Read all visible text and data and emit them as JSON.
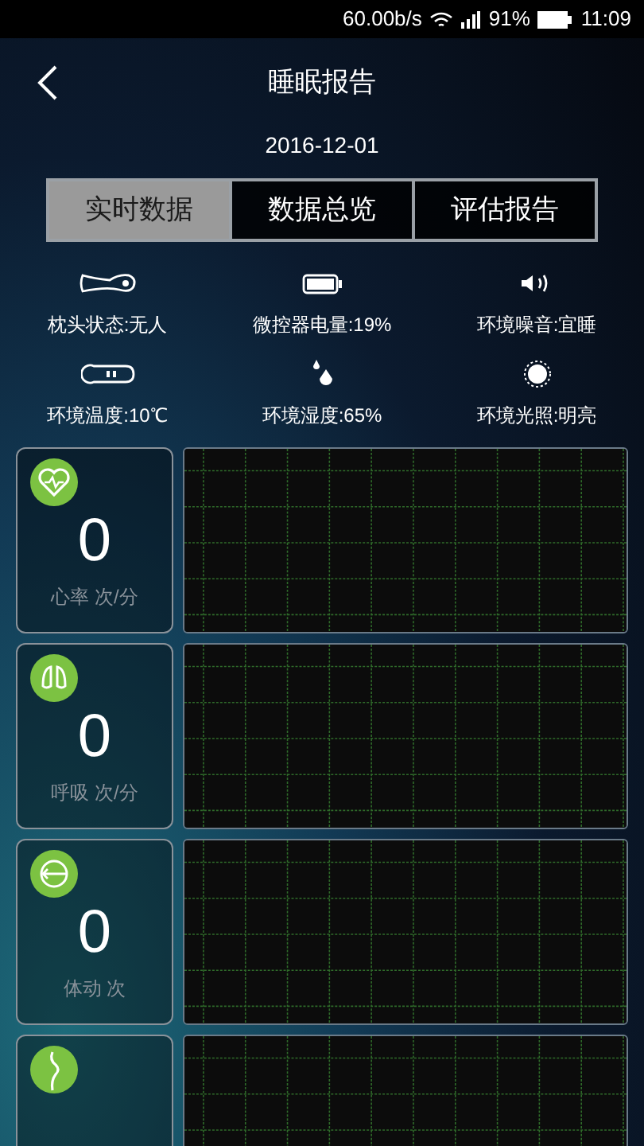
{
  "status_bar": {
    "speed": "60.00b/s",
    "battery": "91%",
    "time": "11:09"
  },
  "header": {
    "title": "睡眠报告",
    "date": "2016-12-01"
  },
  "tabs": [
    {
      "label": "实时数据",
      "selected": true
    },
    {
      "label": "数据总览",
      "selected": false
    },
    {
      "label": "评估报告",
      "selected": false
    }
  ],
  "sensors": [
    {
      "kind": "pillow",
      "label": "枕头状态:无人"
    },
    {
      "kind": "battery",
      "label": "微控器电量:19%"
    },
    {
      "kind": "noise",
      "label": "环境噪音:宜睡"
    },
    {
      "kind": "thermometer",
      "label": "环境温度:10℃"
    },
    {
      "kind": "humidity",
      "label": "环境湿度:65%"
    },
    {
      "kind": "light",
      "label": "环境光照:明亮"
    }
  ],
  "metrics": [
    {
      "kind": "heart",
      "value": "0",
      "label": "心率 次/分"
    },
    {
      "kind": "lungs",
      "value": "0",
      "label": "呼吸 次/分"
    },
    {
      "kind": "movement",
      "value": "0",
      "label": "体动 次"
    },
    {
      "kind": "profile"
    }
  ]
}
